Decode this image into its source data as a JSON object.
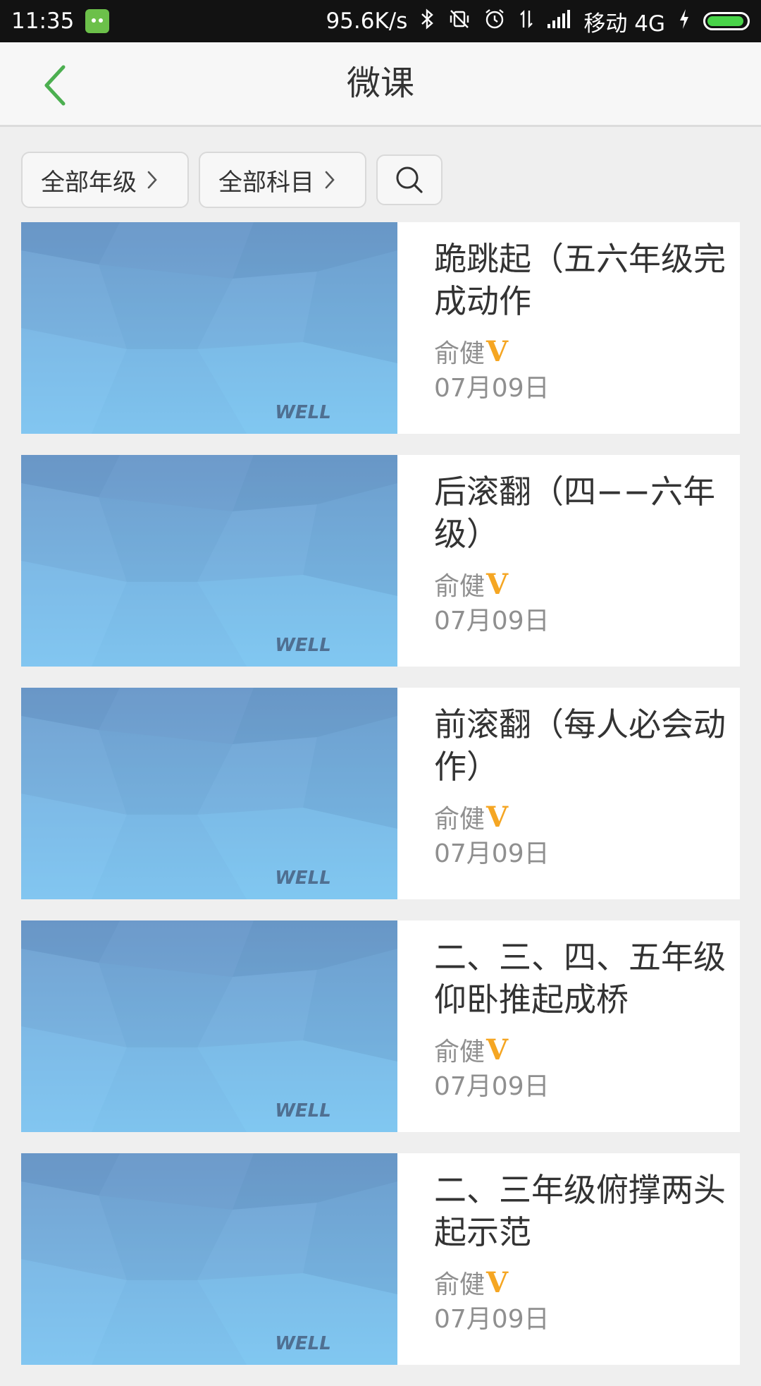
{
  "status_bar": {
    "time": "11:35",
    "network_speed": "95.6K/s",
    "carrier": "移动 4G",
    "icons": [
      "app-notification-icon",
      "bluetooth-icon",
      "vibrate-off-icon",
      "alarm-icon",
      "data-transfer-icon",
      "signal-icon",
      "charging-icon",
      "battery-icon"
    ],
    "battery_level": 0.95
  },
  "app_bar": {
    "title": "微课",
    "back_icon": "chevron-left-icon"
  },
  "filters": {
    "grade_label": "全部年级",
    "subject_label": "全部科目",
    "search_icon": "search-icon"
  },
  "colors": {
    "accent": "#4caf50",
    "verified": "#f5a623",
    "thumb_top": "#6f9fcf",
    "thumb_bottom": "#7fcaf3"
  },
  "courses": [
    {
      "title": "跪跳起（五六年级完成动作",
      "author": "俞健",
      "verified_badge": "V",
      "date": "07月09日",
      "thumb_watermark": "WELL"
    },
    {
      "title": "后滚翻（四−−六年级）",
      "author": "俞健",
      "verified_badge": "V",
      "date": "07月09日",
      "thumb_watermark": "WELL"
    },
    {
      "title": "前滚翻（每人必会动作）",
      "author": "俞健",
      "verified_badge": "V",
      "date": "07月09日",
      "thumb_watermark": "WELL"
    },
    {
      "title": "二、三、四、五年级仰卧推起成桥",
      "author": "俞健",
      "verified_badge": "V",
      "date": "07月09日",
      "thumb_watermark": "WELL"
    },
    {
      "title": "二、三年级俯撑两头起示范",
      "author": "俞健",
      "verified_badge": "V",
      "date": "07月09日",
      "thumb_watermark": "WELL"
    }
  ]
}
